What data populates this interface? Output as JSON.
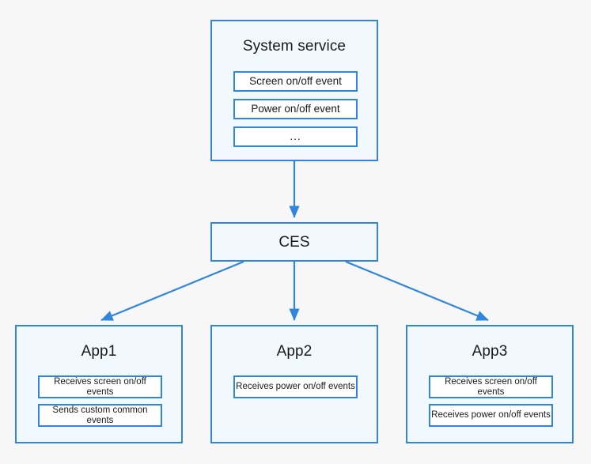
{
  "diagram": {
    "title_visible": false,
    "background_color": "#f7f7f7",
    "node_fill_color": "#f2f9fe",
    "node_border_color": "#2f86db",
    "chip_fill_color": "#ffffff",
    "connector_color": "#2f86db",
    "nodes": {
      "system_service": {
        "title": "System service",
        "chips": [
          "Screen on/off event",
          "Power on/off event",
          "..."
        ]
      },
      "ces": {
        "title": "CES"
      },
      "app1": {
        "title": "App1",
        "chips": [
          "Receives screen on/off events",
          "Sends custom common events"
        ]
      },
      "app2": {
        "title": "App2",
        "chips": [
          "Receives power on/off events"
        ]
      },
      "app3": {
        "title": "App3",
        "chips": [
          "Receives screen on/off events",
          "Receives power on/off events"
        ]
      }
    },
    "connectors": [
      {
        "name": "system-service-to-ces",
        "from": "system_service",
        "to": "ces",
        "style": "vertical-arrow"
      },
      {
        "name": "ces-to-app1",
        "from": "ces",
        "to": "app1",
        "style": "diagonal-arrow-left"
      },
      {
        "name": "ces-to-app2",
        "from": "ces",
        "to": "app2",
        "style": "vertical-arrow"
      },
      {
        "name": "ces-to-app3",
        "from": "ces",
        "to": "app3",
        "style": "diagonal-arrow-right"
      }
    ]
  }
}
